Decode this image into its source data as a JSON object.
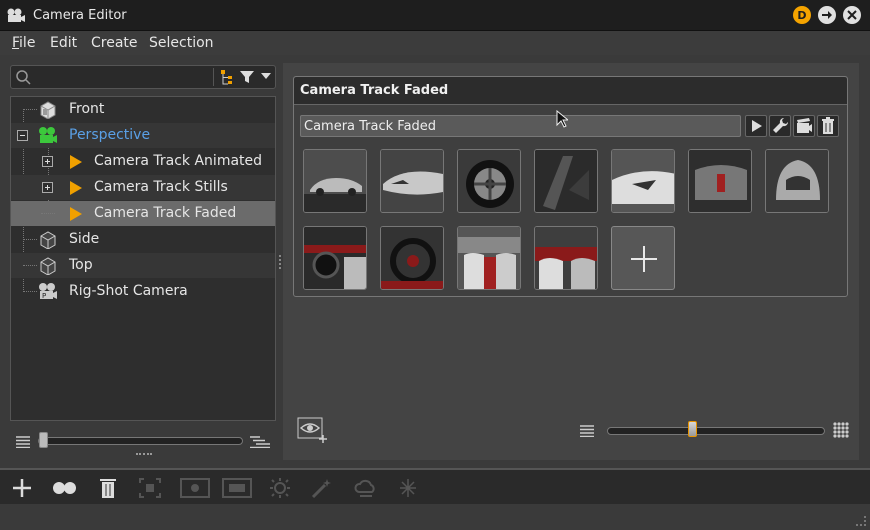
{
  "window": {
    "title": "Camera Editor"
  },
  "titlebar_buttons": {
    "d_label": "D"
  },
  "menu": {
    "items": [
      "File",
      "Edit",
      "Create",
      "Selection"
    ]
  },
  "search": {
    "placeholder": "",
    "value": ""
  },
  "tree": {
    "items": [
      {
        "label": "Front",
        "kind": "camera-view"
      },
      {
        "label": "Perspective",
        "kind": "perspective-camera",
        "expanded": true,
        "highlight": true
      },
      {
        "label": "Camera Track Animated",
        "kind": "camera-track",
        "expandable": true
      },
      {
        "label": "Camera Track Stills",
        "kind": "camera-track",
        "expandable": true
      },
      {
        "label": "Camera Track Faded",
        "kind": "camera-track",
        "selected": true
      },
      {
        "label": "Side",
        "kind": "camera-view"
      },
      {
        "label": "Top",
        "kind": "camera-view"
      },
      {
        "label": "Rig-Shot Camera",
        "kind": "rig-camera"
      }
    ]
  },
  "track_group": {
    "header": "Camera Track Faded",
    "name_value": "Camera Track Faded",
    "thumbnails_count": 11
  },
  "bottom_toolbar": {
    "icons": [
      "add-icon",
      "link-icon",
      "trash-icon",
      "focus-icon",
      "camera-frame-icon",
      "frame-icon",
      "sun-icon",
      "magic-icon",
      "cloud-icon",
      "light-icon"
    ]
  },
  "colors": {
    "accent": "#f5a400",
    "highlight_text": "#5aa0e6",
    "track_arrow": "#f0a000",
    "perspective_icon": "#3cc83c"
  }
}
